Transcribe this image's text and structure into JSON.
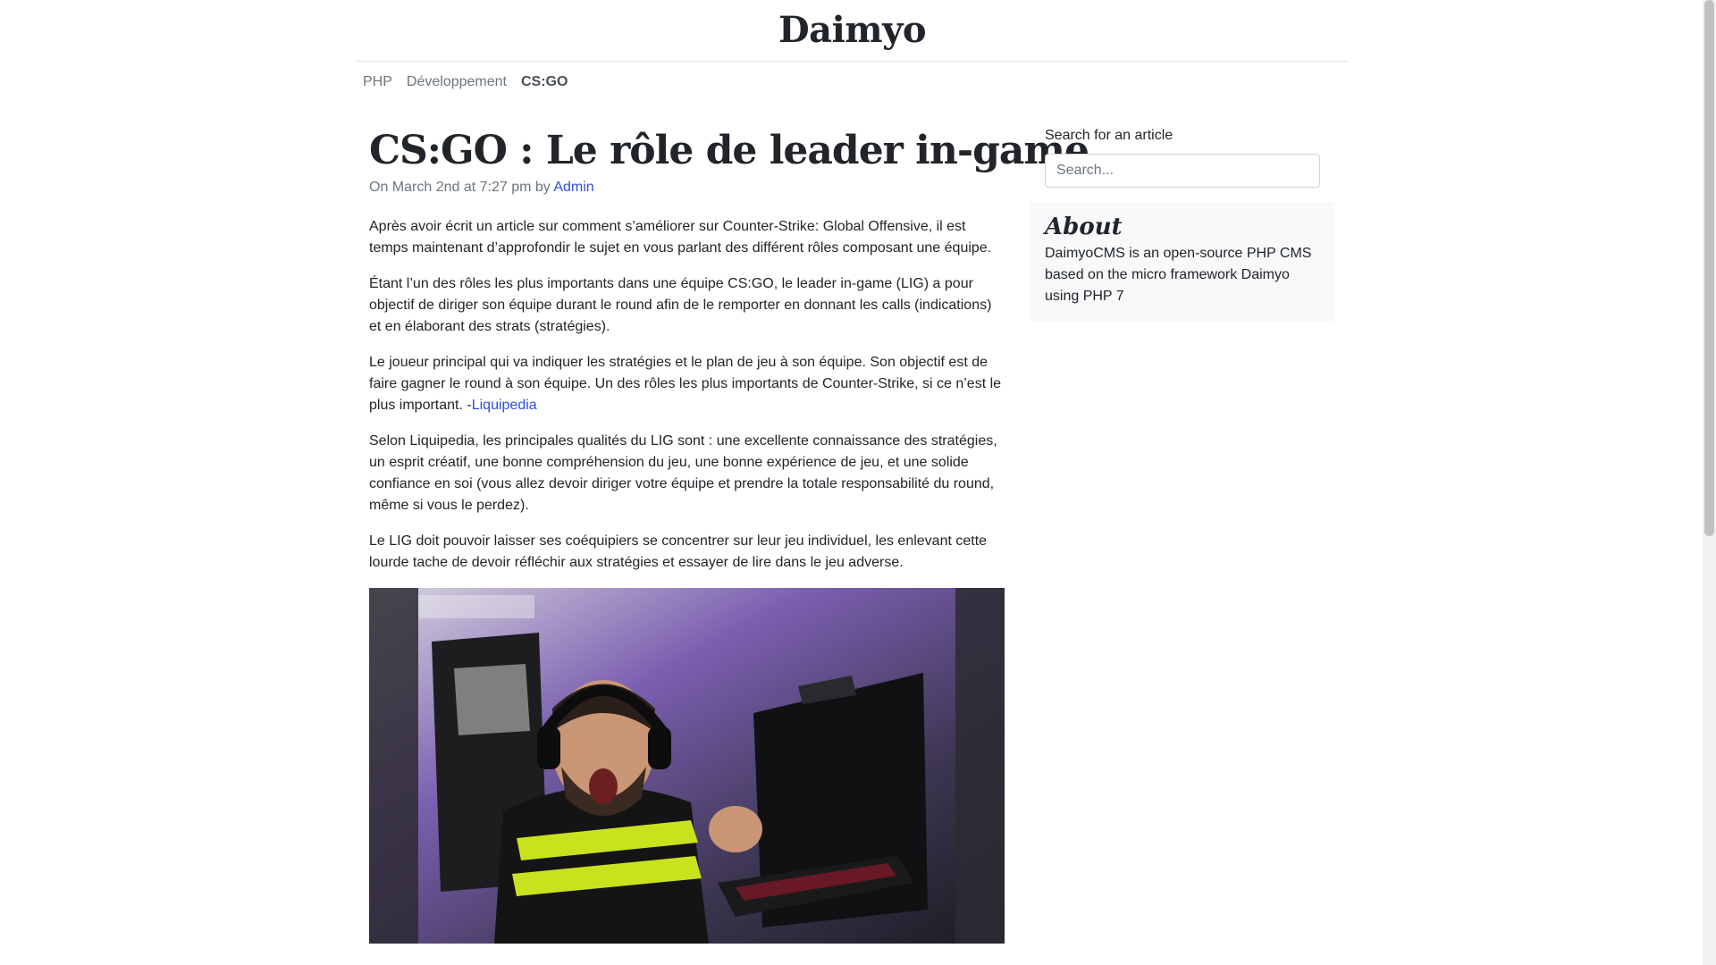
{
  "site": {
    "title": "Daimyo"
  },
  "nav": {
    "items": [
      {
        "label": "PHP"
      },
      {
        "label": "Développement"
      },
      {
        "label": "CS:GO"
      }
    ]
  },
  "post": {
    "title": "CS:GO : Le rôle de leader in-game",
    "meta_prefix": "On March 2nd at 7:27 pm by ",
    "author": "Admin",
    "paragraphs": [
      "Après avoir écrit un article sur comment s’améliorer sur Counter-Strike: Global Offensive, il est temps maintenant d’approfondir le sujet en vous parlant des différent rôles composant une équipe.",
      "Étant l’un des rôles les plus importants dans une équipe CS:GO, le leader in-game (LIG) a pour objectif de diriger son équipe durant le round afin de le remporter en donnant les calls (indications) et en élaborant des strats (stratégies).",
      "Le joueur principal qui va indiquer les stratégies et le plan de jeu à son équipe. Son objectif est de faire gagner le round à son équipe. Un des rôles les plus importants de Counter-Strike, si ce n’est le plus important. -",
      "Selon Liquipedia, les principales qualités du LIG sont : une excellente connaissance des stratégies, un esprit créatif, une bonne compréhension du jeu, une bonne expérience de jeu, et une solide confiance en soi (vous allez devoir diriger votre équipe et prendre la totale responsabilité du round, même si vous le perdez).",
      "Le LIG doit pouvoir laisser ses coéquipiers se concentrer sur leur jeu individuel, les enlevant cette lourde tache de devoir réfléchir aux stratégies et essayer de lire dans le jeu adverse."
    ],
    "quote_link": "Liquipedia"
  },
  "sidebar": {
    "search_label": "Search for an article",
    "search_placeholder": "Search...",
    "about_title": "About",
    "about_text": "DaimyoCMS is an open-source PHP CMS based on the micro framework Daimyo using PHP 7"
  },
  "colors": {
    "link": "#2c4ede",
    "muted": "#6c757d",
    "about_bg": "#f8f9fa"
  }
}
